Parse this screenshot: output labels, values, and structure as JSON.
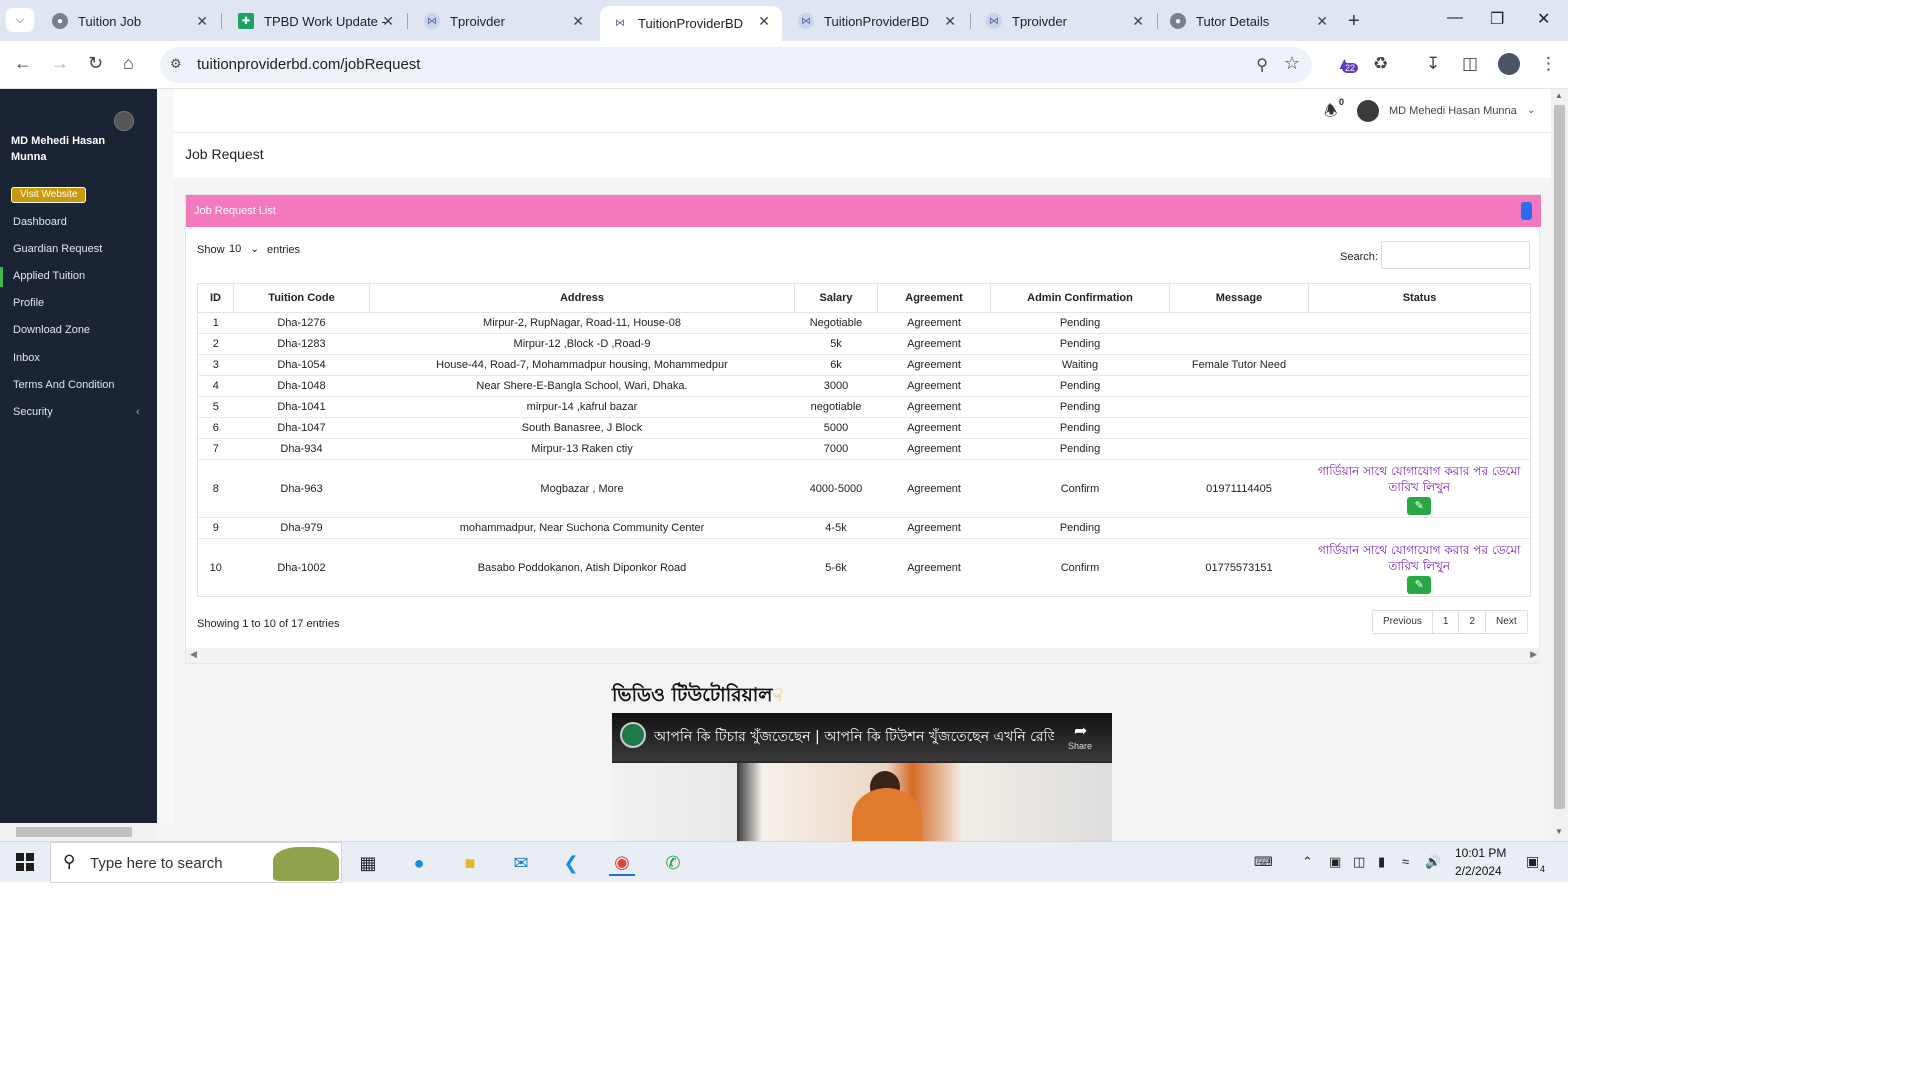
{
  "browser": {
    "tabs": [
      {
        "title": "Tuition Job",
        "active": false
      },
      {
        "title": "TPBD Work Update -",
        "active": false
      },
      {
        "title": "Tproivder",
        "active": false
      },
      {
        "title": "TuitionProviderBD",
        "active": true
      },
      {
        "title": "TuitionProviderBD",
        "active": false
      },
      {
        "title": "Tproivder",
        "active": false
      },
      {
        "title": "Tutor Details",
        "active": false
      }
    ],
    "url": "tuitionproviderbd.com/jobRequest",
    "extension_badge": "22"
  },
  "sidebar": {
    "user_name": "MD Mehedi Hasan Munna",
    "visit_button": "Visit Website",
    "items": [
      {
        "label": "Dashboard"
      },
      {
        "label": "Guardian Request"
      },
      {
        "label": "Applied Tuition"
      },
      {
        "label": "Profile"
      },
      {
        "label": "Download Zone"
      },
      {
        "label": "Inbox"
      },
      {
        "label": "Terms And Condition"
      },
      {
        "label": "Security"
      }
    ],
    "active_item": "Applied Tuition"
  },
  "topbar": {
    "notification_count": "0",
    "user_name": "MD Mehedi Hasan Munna"
  },
  "page": {
    "title": "Job Request",
    "card_title": "Job Request List",
    "show_label": "Show",
    "entries_value": "10",
    "entries_label": "entries",
    "search_label": "Search:",
    "search_value": ""
  },
  "table": {
    "columns": [
      "ID",
      "Tuition Code",
      "Address",
      "Salary",
      "Agreement",
      "Admin Confirmation",
      "Message",
      "Status"
    ],
    "rows": [
      {
        "id": "1",
        "code": "Dha-1276",
        "address": "Mirpur-2, RupNagar, Road-11, House-08",
        "salary": "Negotiable",
        "agreement": "Agreement",
        "confirmation": "Pending",
        "message": "",
        "status": ""
      },
      {
        "id": "2",
        "code": "Dha-1283",
        "address": "Mirpur-12 ,Block -D ,Road-9",
        "salary": "5k",
        "agreement": "Agreement",
        "confirmation": "Pending",
        "message": "",
        "status": ""
      },
      {
        "id": "3",
        "code": "Dha-1054",
        "address": "House-44, Road-7, Mohammadpur housing, Mohammedpur",
        "salary": "6k",
        "agreement": "Agreement",
        "confirmation": "Waiting",
        "message": "Female Tutor Need",
        "status": ""
      },
      {
        "id": "4",
        "code": "Dha-1048",
        "address": "Near Shere-E-Bangla School, Wari, Dhaka.",
        "salary": "3000",
        "agreement": "Agreement",
        "confirmation": "Pending",
        "message": "",
        "status": ""
      },
      {
        "id": "5",
        "code": "Dha-1041",
        "address": "mirpur-14 ,kafrul bazar",
        "salary": "negotiable",
        "agreement": "Agreement",
        "confirmation": "Pending",
        "message": "",
        "status": ""
      },
      {
        "id": "6",
        "code": "Dha-1047",
        "address": "South Banasree, J Block",
        "salary": "5000",
        "agreement": "Agreement",
        "confirmation": "Pending",
        "message": "",
        "status": ""
      },
      {
        "id": "7",
        "code": "Dha-934",
        "address": "Mirpur-13 Raken ctiy",
        "salary": "7000",
        "agreement": "Agreement",
        "confirmation": "Pending",
        "message": "",
        "status": ""
      },
      {
        "id": "8",
        "code": "Dha-963",
        "address": "Mogbazar , More",
        "salary": "4000-5000",
        "agreement": "Agreement",
        "confirmation": "Confirm",
        "message": "01971114405",
        "status": "গার্ডিয়ান সাথে যোগাযোগ করার পর ডেমো তারিখ লিখুন"
      },
      {
        "id": "9",
        "code": "Dha-979",
        "address": "mohammadpur, Near Suchona Community Center",
        "salary": "4-5k",
        "agreement": "Agreement",
        "confirmation": "Pending",
        "message": "",
        "status": ""
      },
      {
        "id": "10",
        "code": "Dha-1002",
        "address": "Basabo Poddokanon, Atish Diponkor Road",
        "salary": "5-6k",
        "agreement": "Agreement",
        "confirmation": "Confirm",
        "message": "01775573151",
        "status": "গার্ডিয়ান সাথে যোগাযোগ করার পর ডেমো তারিখ লিখুন"
      }
    ]
  },
  "footer": {
    "info": "Showing 1 to 10 of 17 entries",
    "pagination": [
      "Previous",
      "1",
      "2",
      "Next"
    ]
  },
  "tutorial": {
    "heading": "ভিডিও টিউটোরিয়াল",
    "video_title": "আপনি কি টিচার খুঁজতেছেন | আপনি কি টিউশন খুঁজতেছেন এখনি রেজিস্ট্রেশন",
    "share_label": "Share"
  },
  "taskbar": {
    "search_placeholder": "Type here to search",
    "time": "10:01 PM",
    "date": "2/2/2024",
    "notification_count": "4"
  },
  "colors": {
    "sidebar_bg": "#1b2434",
    "card_header": "#f378be",
    "status_text": "#7a1cc4",
    "edit_button": "#28a745",
    "visit_button": "#c79a0a"
  }
}
